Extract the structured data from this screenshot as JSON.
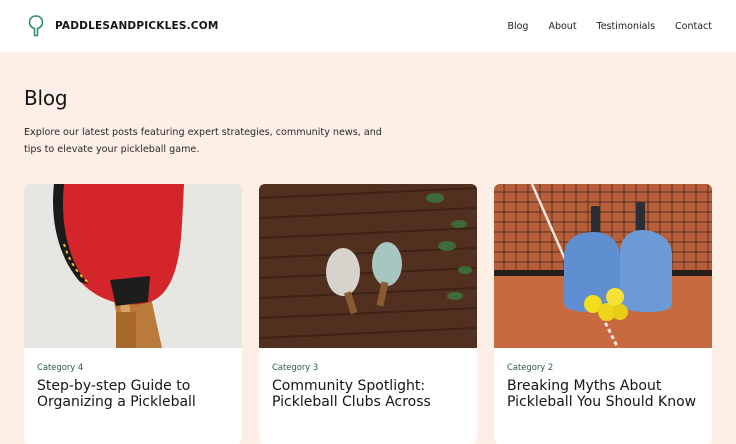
{
  "brand": {
    "name": "PADDLESANDPICKLES.COM",
    "logo_icon": "paddle-icon",
    "accent": "#2f8f6f"
  },
  "nav": {
    "items": [
      "Blog",
      "About",
      "Testimonials",
      "Contact"
    ]
  },
  "hero": {
    "title": "Blog",
    "description": "Explore our latest posts featuring expert strategies, community news, and tips to elevate your pickleball game."
  },
  "posts": [
    {
      "category": "Category 4",
      "title": "Step-by-step Guide to Organizing a Pickleball",
      "image": "red-paddle-photo"
    },
    {
      "category": "Category 3",
      "title": "Community Spotlight: Pickleball Clubs Across",
      "image": "paddles-on-wooden-wall-photo"
    },
    {
      "category": "Category 2",
      "title": "Breaking Myths About Pickleball You Should Know",
      "image": "blue-paddles-on-court-photo"
    }
  ],
  "colors": {
    "page_bg": "#fdeee6",
    "header_bg": "#ffffff",
    "category_text": "#2a5a4a"
  }
}
